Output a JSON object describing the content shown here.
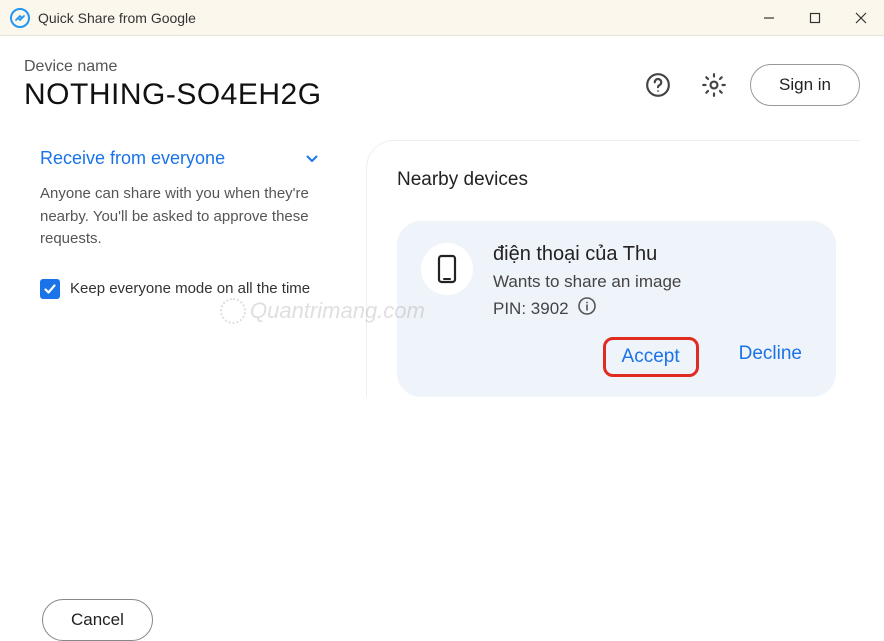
{
  "titlebar": {
    "title": "Quick Share from Google"
  },
  "header": {
    "device_name_label": "Device name",
    "device_name": "NOTHING-SO4EH2G",
    "signin_label": "Sign in"
  },
  "left": {
    "receive_label": "Receive from everyone",
    "receive_desc": "Anyone can share with you when they're nearby. You'll be asked to approve these requests.",
    "keep_label": "Keep everyone mode on all the time",
    "keep_checked": true
  },
  "right": {
    "nearby_title": "Nearby devices",
    "card": {
      "sender": "điện thoại của Thu",
      "message": "Wants to share an image",
      "pin_label": "PIN: 3902",
      "accept": "Accept",
      "decline": "Decline"
    }
  },
  "footer": {
    "cancel": "Cancel"
  },
  "watermark": "Quantrimang.com"
}
